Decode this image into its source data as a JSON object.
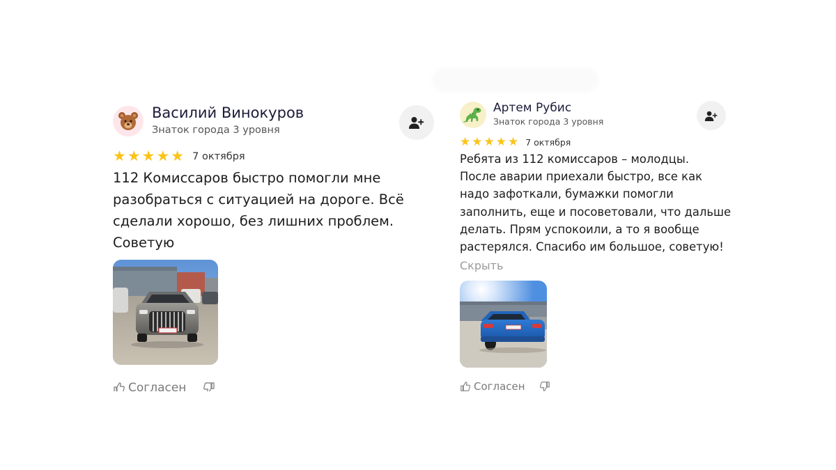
{
  "reviews": [
    {
      "author": "Василий Винокуров",
      "level": "Знаток города 3 уровня",
      "avatar_icon": "bear-emoji",
      "rating": 5,
      "stars": "★★★★★",
      "date": "7 октября",
      "text_lines": [
        "112 Комиссаров быстро помогли мне",
        "разобраться с ситуацией на дороге. Всё",
        "сделали хорошо, без лишних проблем.",
        "Советую"
      ],
      "photo": "grey sedan with large chrome grille parked in a lot near grey buildings",
      "agree_label": "Согласен"
    },
    {
      "author": "Артем Рубис",
      "level": "Знаток города 3 уровня",
      "avatar_icon": "dinosaur-emoji",
      "rating": 5,
      "stars": "★★★★★",
      "date": "7 октября",
      "text_lines": [
        "Ребята из 112 комиссаров – молодцы.",
        "После аварии приехали быстро, все как",
        "надо зафоткали, бумажки помогли",
        "заполнить, еще и посоветовали, что дальше",
        "делать. Прям успокоили, а то я вообще",
        "растерялся. Спасибо им большое, советую!"
      ],
      "hide_label": "Скрыть",
      "photo": "blue sedan with damaged rear parked near a building",
      "agree_label": "Согласен"
    }
  ],
  "colors": {
    "star": "#fcc419",
    "muted": "#9a9a9a",
    "name": "#1b1b3a"
  }
}
